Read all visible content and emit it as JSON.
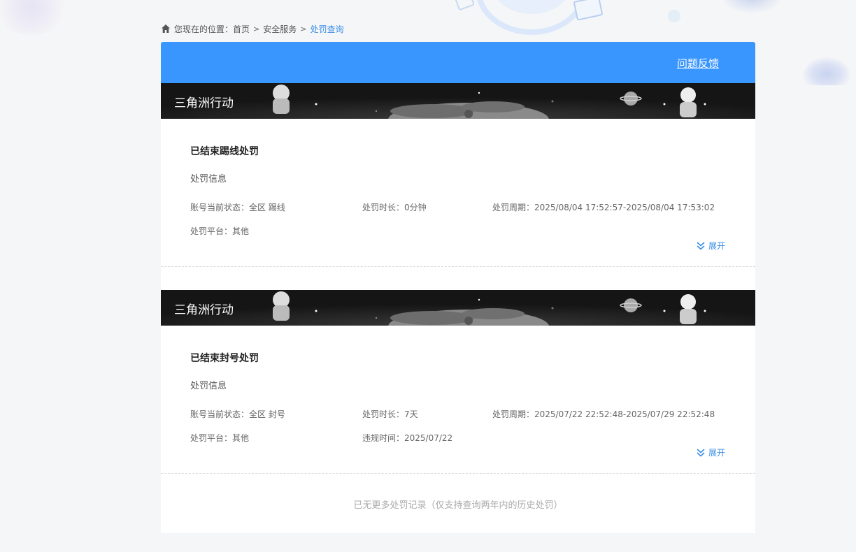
{
  "breadcrumb": {
    "prefix": "您现在的位置：",
    "items": [
      "首页",
      "安全服务"
    ],
    "current": "处罚查询",
    "separator": ">"
  },
  "header": {
    "feedback_label": "问题反馈",
    "bg_color": "#3a96ff"
  },
  "records": [
    {
      "game_title": "三角洲行动",
      "status_title": "已结束踢线处罚",
      "section_label": "处罚信息",
      "account_state": "账号当前状态：全区 踢线",
      "duration": "处罚时长：0分钟",
      "period": "处罚周期：2025/08/04 17:52:57-2025/08/04 17:53:02",
      "platform": "处罚平台：其他",
      "expand_label": "展开"
    },
    {
      "game_title": "三角洲行动",
      "status_title": "已结束封号处罚",
      "section_label": "处罚信息",
      "account_state": "账号当前状态：全区 封号",
      "duration": "处罚时长：7天",
      "period": "处罚周期：2025/07/22 22:52:48-2025/07/29 22:52:48",
      "platform": "处罚平台：其他",
      "violation_time": "违规时间：2025/07/22",
      "expand_label": "展开"
    }
  ],
  "footer_note": "已无更多处罚记录（仅支持查询两年内的历史处罚）",
  "accent_color": "#3a8ee6",
  "icons": [
    "home-icon",
    "double-chevron-down-icon"
  ]
}
